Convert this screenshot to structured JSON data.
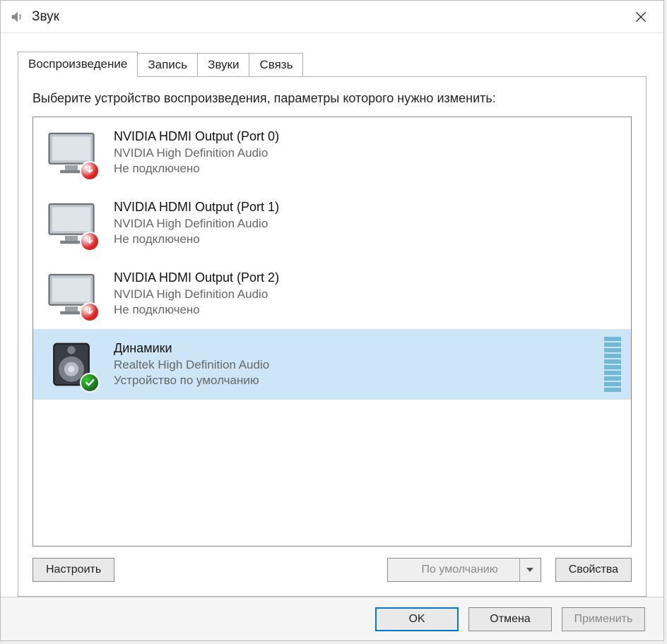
{
  "window": {
    "title": "Звук"
  },
  "tabs": [
    {
      "label": "Воспроизведение",
      "active": true
    },
    {
      "label": "Запись",
      "active": false
    },
    {
      "label": "Звуки",
      "active": false
    },
    {
      "label": "Связь",
      "active": false
    }
  ],
  "instruction": "Выберите устройство воспроизведения, параметры которого нужно изменить:",
  "devices": [
    {
      "name": "NVIDIA HDMI Output (Port 0)",
      "driver": "NVIDIA High Definition Audio",
      "status": "Не подключено",
      "state": "unplugged",
      "icon": "monitor",
      "selected": false
    },
    {
      "name": "NVIDIA HDMI Output (Port 1)",
      "driver": "NVIDIA High Definition Audio",
      "status": "Не подключено",
      "state": "unplugged",
      "icon": "monitor",
      "selected": false
    },
    {
      "name": "NVIDIA HDMI Output (Port 2)",
      "driver": "NVIDIA High Definition Audio",
      "status": "Не подключено",
      "state": "unplugged",
      "icon": "monitor",
      "selected": false
    },
    {
      "name": "Динамики",
      "driver": "Realtek High Definition Audio",
      "status": "Устройство по умолчанию",
      "state": "default",
      "icon": "speaker",
      "selected": true
    }
  ],
  "panel_buttons": {
    "configure": "Настроить",
    "set_default": "По умолчанию",
    "properties": "Свойства"
  },
  "dialog_buttons": {
    "ok": "OK",
    "cancel": "Отмена",
    "apply": "Применить"
  }
}
